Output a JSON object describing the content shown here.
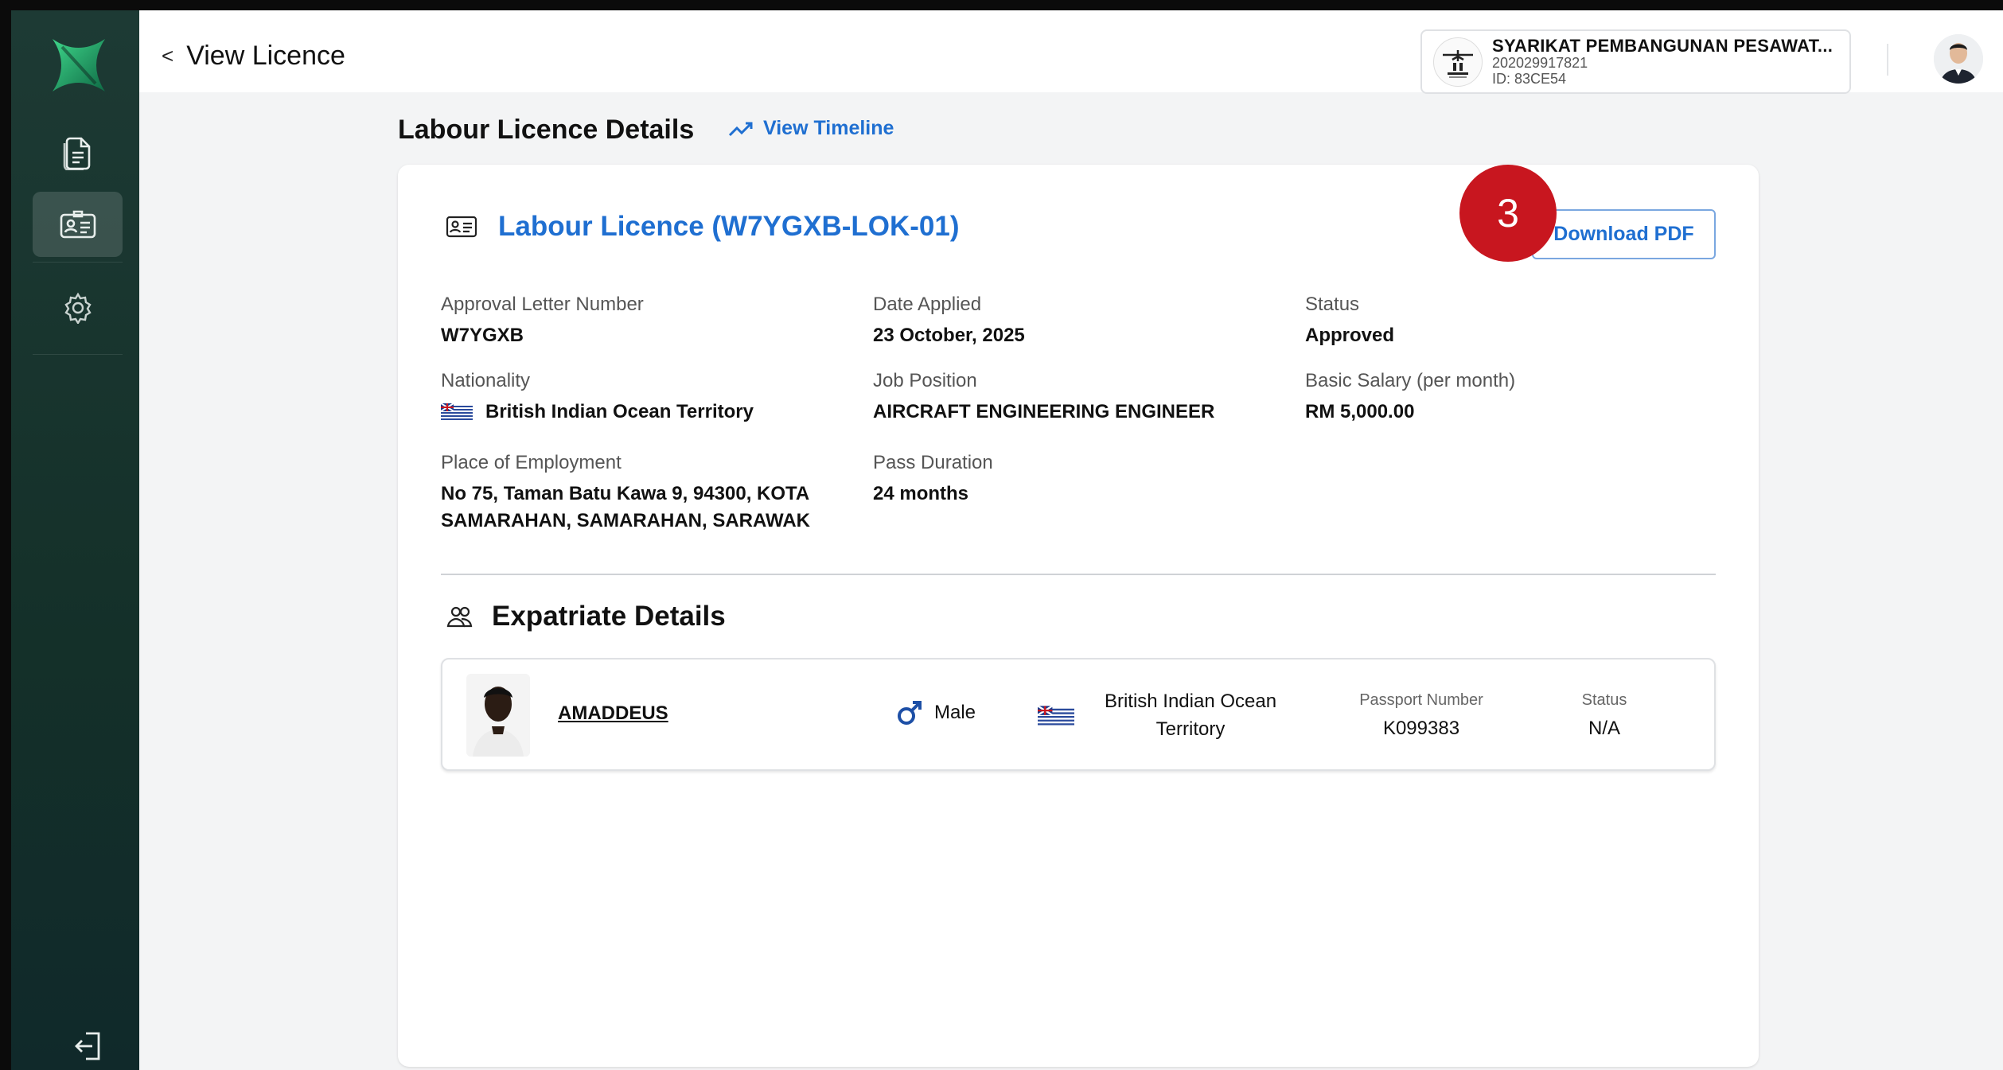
{
  "header": {
    "back_label": "View Licence",
    "company_name": "SYARIKAT PEMBANGUNAN PESAWAT...",
    "company_reg": "202029917821",
    "company_id": "ID: 83CE54"
  },
  "sidebar": {
    "items": [
      {
        "icon": "document-icon",
        "active": false
      },
      {
        "icon": "id-card-icon",
        "active": true
      },
      {
        "icon": "gear-icon",
        "active": false
      }
    ],
    "logout_icon": "logout-icon"
  },
  "page": {
    "section_title": "Labour Licence Details",
    "timeline_label": "View Timeline"
  },
  "licence": {
    "title": "Labour Licence (W7YGXB-LOK-01)",
    "download_label": "Download PDF",
    "badge_number": "3",
    "fields": {
      "approval_label": "Approval Letter Number",
      "approval_value": "W7YGXB",
      "date_label": "Date Applied",
      "date_value": "23 October, 2025",
      "status_label": "Status",
      "status_value": "Approved",
      "nationality_label": "Nationality",
      "nationality_value": "British Indian Ocean Territory",
      "job_label": "Job Position",
      "job_value": "AIRCRAFT ENGINEERING ENGINEER",
      "salary_label": "Basic Salary (per month)",
      "salary_value": "RM 5,000.00",
      "place_label": "Place of Employment",
      "place_value_line1": "No 75, Taman Batu Kawa 9, 94300, KOTA",
      "place_value_line2": "SAMARAHAN, SAMARAHAN, SARAWAK",
      "duration_label": "Pass Duration",
      "duration_value": "24 months"
    }
  },
  "expatriate": {
    "section_title": "Expatriate Details",
    "name": "AMADDEUS",
    "gender": "Male",
    "nationality_line1": "British Indian Ocean",
    "nationality_line2": "Territory",
    "passport_label": "Passport Number",
    "passport_value": "K099383",
    "status_label": "Status",
    "status_value": "N/A"
  },
  "colors": {
    "accent": "#1f6fd1",
    "sidebar": "#143029",
    "badge": "#c8161f"
  }
}
